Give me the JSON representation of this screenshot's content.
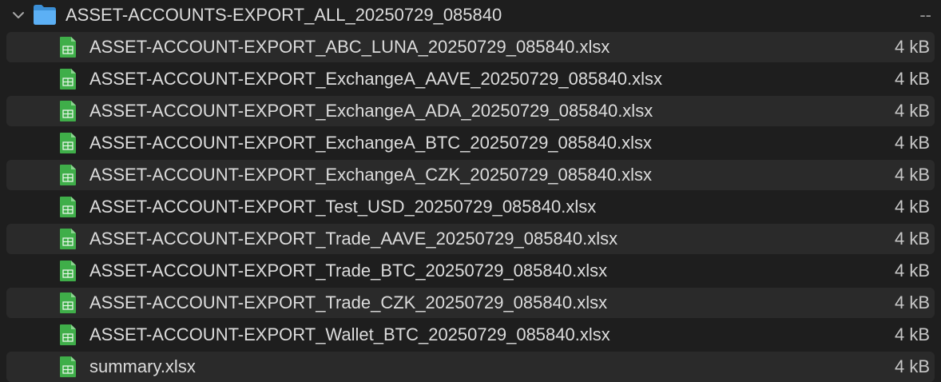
{
  "folder": {
    "name": "ASSET-ACCOUNTS-EXPORT_ALL_20250729_085840",
    "size": "--",
    "expanded": true,
    "icon": "folder-icon",
    "color": "#4ba3f0"
  },
  "files": [
    {
      "name": "ASSET-ACCOUNT-EXPORT_ABC_LUNA_20250729_085840.xlsx",
      "size": "4 kB"
    },
    {
      "name": "ASSET-ACCOUNT-EXPORT_ExchangeA_AAVE_20250729_085840.xlsx",
      "size": "4 kB"
    },
    {
      "name": "ASSET-ACCOUNT-EXPORT_ExchangeA_ADA_20250729_085840.xlsx",
      "size": "4 kB"
    },
    {
      "name": "ASSET-ACCOUNT-EXPORT_ExchangeA_BTC_20250729_085840.xlsx",
      "size": "4 kB"
    },
    {
      "name": "ASSET-ACCOUNT-EXPORT_ExchangeA_CZK_20250729_085840.xlsx",
      "size": "4 kB"
    },
    {
      "name": "ASSET-ACCOUNT-EXPORT_Test_USD_20250729_085840.xlsx",
      "size": "4 kB"
    },
    {
      "name": "ASSET-ACCOUNT-EXPORT_Trade_AAVE_20250729_085840.xlsx",
      "size": "4 kB"
    },
    {
      "name": "ASSET-ACCOUNT-EXPORT_Trade_BTC_20250729_085840.xlsx",
      "size": "4 kB"
    },
    {
      "name": "ASSET-ACCOUNT-EXPORT_Trade_CZK_20250729_085840.xlsx",
      "size": "4 kB"
    },
    {
      "name": "ASSET-ACCOUNT-EXPORT_Wallet_BTC_20250729_085840.xlsx",
      "size": "4 kB"
    },
    {
      "name": "summary.xlsx",
      "size": "4 kB"
    }
  ],
  "file_icon": "spreadsheet-file-icon",
  "colors": {
    "background": "#1e1e1e",
    "alt_row": "#2a2a2a",
    "spreadsheet_green": "#3fae49"
  }
}
